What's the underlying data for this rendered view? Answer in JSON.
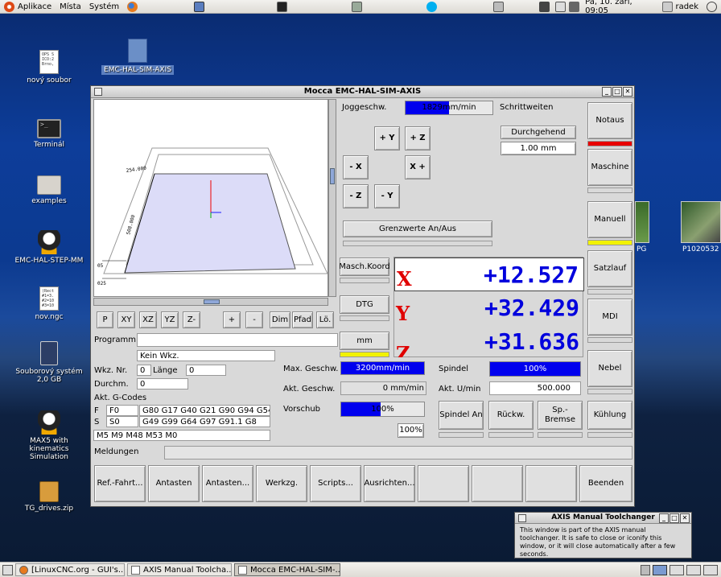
{
  "topbar": {
    "applications": "Aplikace",
    "places": "Místa",
    "system": "Systém",
    "datetime": "Pá, 10. září, 09:05",
    "user": "radek"
  },
  "desktop": {
    "icons": [
      "nový soubor",
      "Terminál",
      "examples",
      "EMC-HAL-STEP-MM",
      "nov.ngc",
      "Souborový systém 2,0 GB",
      "MAX5 with kinematics Simulation",
      "TG_drives.zip",
      "EMC-HAL-SIM-AXIS"
    ],
    "doc_preview": "OPS S\nICO:2\nBrno,",
    "ngc_preview": "(Rect\n#1=3.\n#2=10\n#3=10",
    "right_image_label_1": "PG",
    "right_image_label_2": "P1020532"
  },
  "window": {
    "title": "Mocca EMC-HAL-SIM-AXIS",
    "jog": {
      "label": "Joggeschw.",
      "value": "1829mm/min",
      "fill": 0.5,
      "step_label": "Schrittweiten",
      "step_mode": "Durchgehend",
      "step_size": "1.00 mm"
    },
    "jog_buttons": {
      "yplus": "+ Y",
      "zplus": "+ Z",
      "xminus": "- X",
      "xplus": "X +",
      "zminus": "- Z",
      "yminus": "- Y"
    },
    "limits_button": "Grenzwerte An/Aus",
    "coord_button": "Masch.Koord",
    "dtg_button": "DTG",
    "unit_button": "mm",
    "dro": [
      {
        "axis": "X",
        "value": "+12.527"
      },
      {
        "axis": "Y",
        "value": "+32.429"
      },
      {
        "axis": "Z",
        "value": "+31.636"
      }
    ],
    "side_buttons": [
      "Notaus",
      "Maschine",
      "Manuell",
      "Satzlauf",
      "MDI",
      "Nebel",
      "Kühlung"
    ],
    "view_buttons": [
      "P",
      "XY",
      "XZ",
      "YZ",
      "Z-",
      "+",
      "-",
      "Dim",
      "Pfad",
      "Lö."
    ],
    "program_label": "Programm",
    "program_value": "",
    "tool": {
      "name": "Kein Wkz.",
      "nr_label": "Wkz. Nr.",
      "nr_value": "0",
      "length_label": "Länge",
      "length_value": "0",
      "diam_label": "Durchm.",
      "diam_value": "0"
    },
    "gcodes_label": "Akt. G-Codes",
    "f_label": "F",
    "f_value": "F0",
    "s_label": "S",
    "s_value": "S0",
    "gcodes_line1": "G80 G17 G40 G21 G90 G94 G54",
    "gcodes_line2": "G49 G99 G64 G97 G91.1 G8",
    "mcodes": "M5 M9 M48 M53 M0",
    "max_speed_label": "Max. Geschw.",
    "max_speed_value": "3200mm/min",
    "cur_speed_label": "Akt. Geschw.",
    "cur_speed_value": "0 mm/min",
    "feed_label": "Vorschub",
    "feed_value": "100%",
    "feed_pct": "100%",
    "spindle_label": "Spindel",
    "spindle_value": "100%",
    "rpm_label": "Akt. U/min",
    "rpm_value": "500.000",
    "spindle_buttons": [
      "Spindel An",
      "Rückw.",
      "Sp.-Bremse"
    ],
    "messages_label": "Meldungen",
    "bottom_buttons": [
      "Ref.-Fahrt...",
      "Antasten",
      "Antasten...",
      "Werkzg.",
      "Scripts...",
      "Ausrichten...",
      "",
      "",
      "",
      "Beenden"
    ],
    "preview_labels": {
      "top": "254.000",
      "side": "508.000",
      "left1": "05",
      "left2": "025"
    }
  },
  "dialog": {
    "title": "AXIS Manual Toolchanger",
    "text": "This window is part of the AXIS manual toolchanger.  It is safe to close or iconify this window, or it will close automatically after a few seconds."
  },
  "taskbar": [
    "[LinuxCNC.org - GUI's...",
    "AXIS Manual Toolcha...",
    "Mocca EMC-HAL-SIM-..."
  ]
}
